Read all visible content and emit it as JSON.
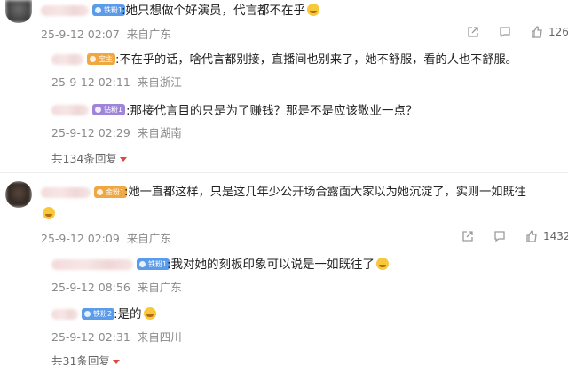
{
  "comments": [
    {
      "badge": "铁粉1",
      "text": ":她只想做个好演员，代言都不在乎",
      "emoji": "laugh-cry-emoji",
      "time": "25-9-12 02:07",
      "location": "来自广东",
      "likes": "126",
      "replies": [
        {
          "badge": "宝主",
          "text": ":不在乎的话，啥代言都别接，直播间也别来了，她不舒服，看的人也不舒服。",
          "time": "25-9-12 02:11",
          "location": "来自浙江"
        },
        {
          "badge": "钻粉1",
          "text": ":那接代言目的只是为了赚钱？那是不是应该敬业一点？",
          "time": "25-9-12 02:29",
          "location": "来自湖南"
        }
      ],
      "more_replies": "共134条回复"
    },
    {
      "badge": "金粉1",
      "text": ":她一直都这样，只是这几年少公开场合露面大家以为她沉淀了，实则一如既往",
      "emoji": "laugh-cry-emoji",
      "time": "25-9-12 02:09",
      "location": "来自广东",
      "likes": "1432",
      "replies": [
        {
          "badge": "铁粉1",
          "text": ":我对她的刻板印象可以说是一如既往了",
          "emoji": "wink-emoji",
          "time": "25-9-12 08:56",
          "location": "来自广东"
        },
        {
          "badge": "铁粉2",
          "text": ":是的",
          "emoji": "laugh-cry-emoji",
          "time": "25-9-12 02:31",
          "location": "来自四川"
        }
      ],
      "more_replies": "共31条回复"
    }
  ]
}
